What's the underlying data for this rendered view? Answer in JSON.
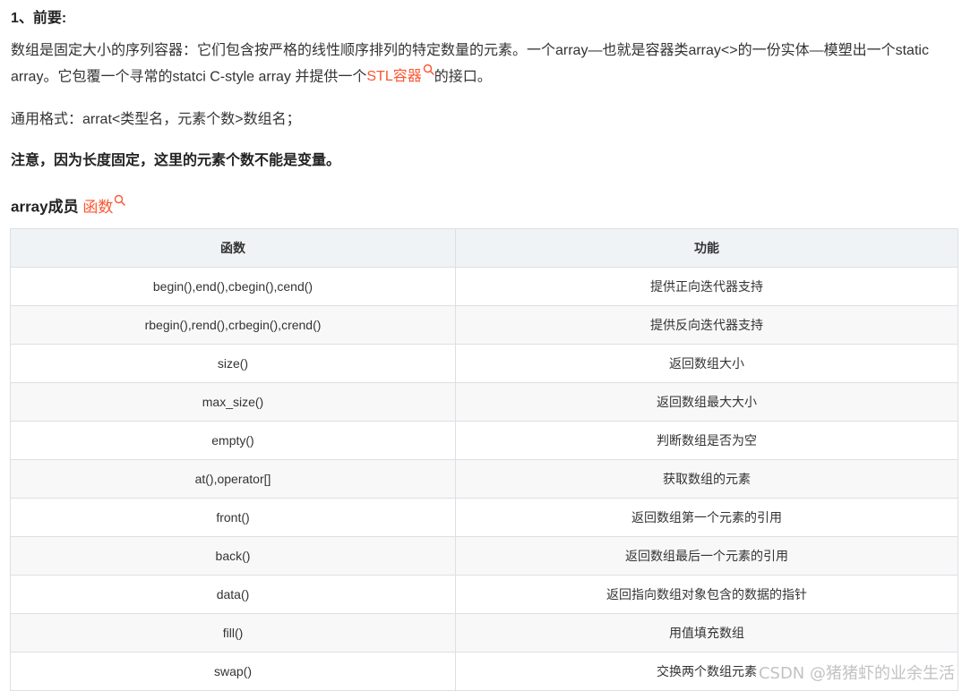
{
  "article": {
    "heading": "1、前要:",
    "intro_part1": "数组是固定大小的序列容器：它们包含按严格的线性顺序排列的特定数量的元素。一个array—也就是容器类array<>的一份实体—模塑出一个static array。它包覆一个寻常的statci C-style array 并提供一个",
    "intro_link": "STL容器",
    "intro_part2": "的接口。",
    "format": "通用格式：arrat<类型名，元素个数>数组名；",
    "note": "注意，因为长度固定，这里的元素个数不能是变量。",
    "members_heading": "array成员",
    "members_link": "函数"
  },
  "table": {
    "headers": [
      "函数",
      "功能"
    ],
    "rows": [
      [
        "begin(),end(),cbegin(),cend()",
        "提供正向迭代器支持"
      ],
      [
        "rbegin(),rend(),crbegin(),crend()",
        "提供反向迭代器支持"
      ],
      [
        "size()",
        "返回数组大小"
      ],
      [
        "max_size()",
        "返回数组最大大小"
      ],
      [
        "empty()",
        "判断数组是否为空"
      ],
      [
        "at(),operator[]",
        "获取数组的元素"
      ],
      [
        "front()",
        "返回数组第一个元素的引用"
      ],
      [
        "back()",
        "返回数组最后一个元素的引用"
      ],
      [
        "data()",
        "返回指向数组对象包含的数据的指针"
      ],
      [
        "fill()",
        "用值填充数组"
      ],
      [
        "swap()",
        "交换两个数组元素"
      ]
    ]
  },
  "watermark": "CSDN @猪猪虾的业余生活",
  "colors": {
    "link": "#fc5531",
    "table_header_bg": "#eff3f5",
    "table_border": "#dddfe4"
  },
  "icons": {
    "link_suffix": "search-icon"
  }
}
